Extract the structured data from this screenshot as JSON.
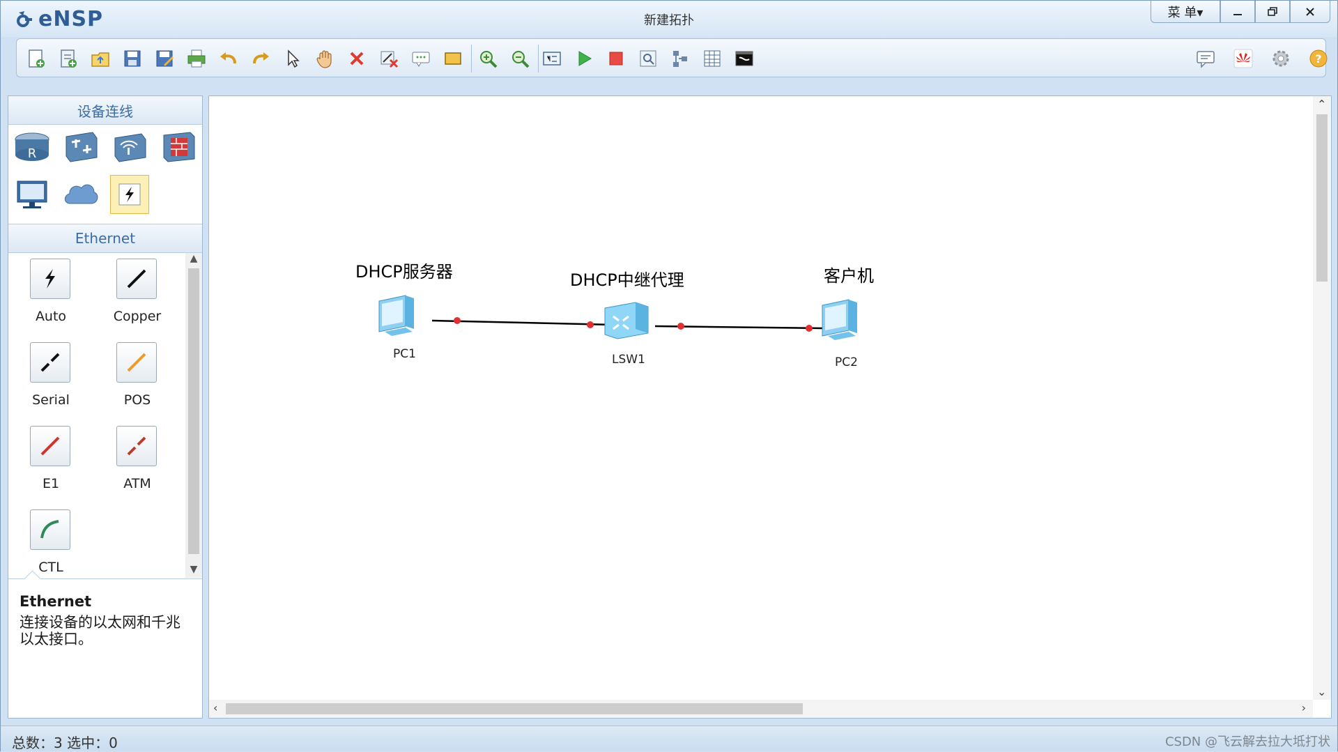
{
  "app": {
    "logo_text": "eNSP",
    "window_title": "新建拓扑"
  },
  "window_controls": {
    "menu_label": "菜 单▾",
    "minimize": "—",
    "maximize": "🗗",
    "close": "✕"
  },
  "toolbar": {
    "left_icons": [
      "new-topology-icon",
      "new-lab-icon",
      "open-icon",
      "save-icon",
      "save-as-icon",
      "print-icon",
      "undo-icon",
      "redo-icon",
      "select-icon",
      "pan-hand-icon",
      "delete-icon",
      "delete-link-icon",
      "text-note-icon",
      "rectangle-icon",
      "zoom-in-icon",
      "zoom-out-icon",
      "fit-view-icon",
      "start-device-icon",
      "stop-device-icon",
      "capture-icon",
      "topology-icon",
      "grid-icon",
      "terminal-icon"
    ],
    "right_icons": [
      "chat-icon",
      "huawei-icon",
      "settings-icon",
      "help-icon"
    ]
  },
  "left_panel": {
    "section_title": "设备连线",
    "devices": [
      "router-icon",
      "switch-icon",
      "wireless-icon",
      "firewall-icon",
      "pc-icon",
      "cloud-icon",
      "cable-icon"
    ],
    "subsection_title": "Ethernet",
    "cables": [
      {
        "label": "Auto",
        "icon": "auto-cable-icon",
        "color": "#111111"
      },
      {
        "label": "Copper",
        "icon": "copper-cable-icon",
        "color": "#111111"
      },
      {
        "label": "Serial",
        "icon": "serial-cable-icon",
        "color": "#111111"
      },
      {
        "label": "POS",
        "icon": "pos-cable-icon",
        "color": "#f39a1f"
      },
      {
        "label": "E1",
        "icon": "e1-cable-icon",
        "color": "#d9302a"
      },
      {
        "label": "ATM",
        "icon": "atm-cable-icon",
        "color": "#c0392b"
      },
      {
        "label": "CTL",
        "icon": "ctl-cable-icon",
        "color": "#2e8b57"
      }
    ],
    "description": {
      "title": "Ethernet",
      "body": "连接设备的以太网和千兆以太接口。"
    }
  },
  "topology": {
    "nodes": [
      {
        "id": "pc1",
        "label": "DHCP服务器",
        "name": "PC1",
        "type": "pc"
      },
      {
        "id": "lsw1",
        "label": "DHCP中继代理",
        "name": "LSW1",
        "type": "switch"
      },
      {
        "id": "pc2",
        "label": "客户机",
        "name": "PC2",
        "type": "pc"
      }
    ],
    "link_color": "#000000",
    "port_color": "#e03030"
  },
  "statusbar": {
    "text": "总数：3  选中：0",
    "watermark": "CSDN @飞云解去拉大坻打状"
  }
}
